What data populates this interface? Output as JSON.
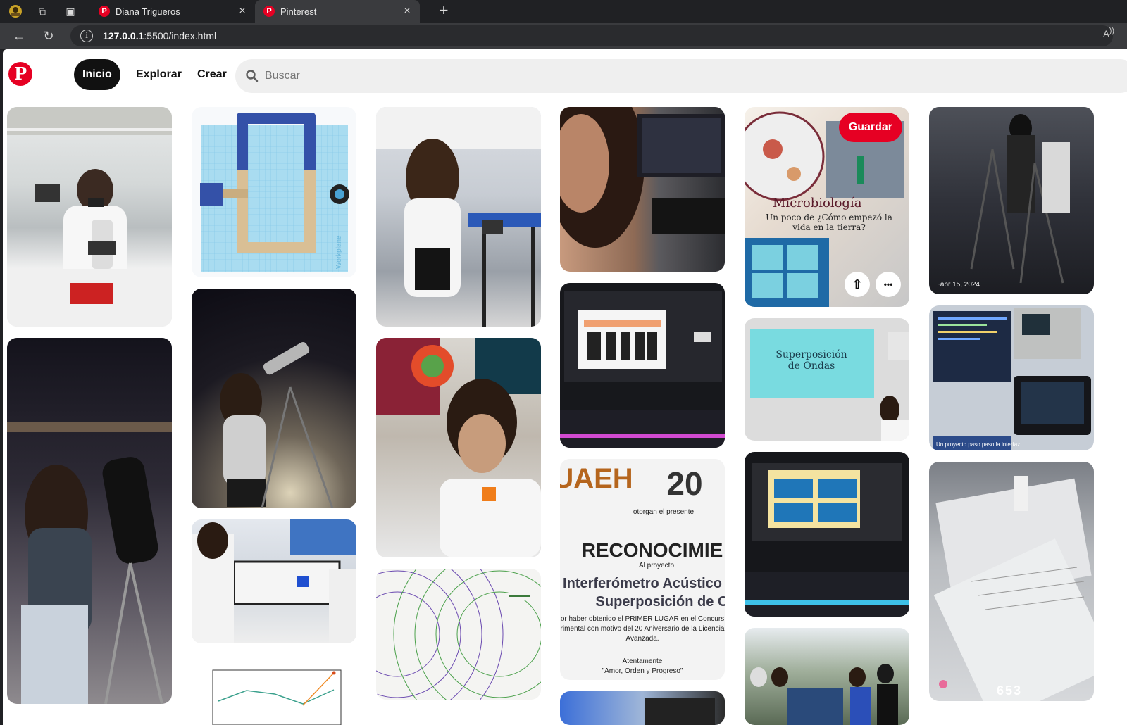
{
  "browser": {
    "tabs": [
      {
        "label": "Diana Trigueros",
        "close": "×"
      },
      {
        "label": "Pinterest",
        "close": "×"
      }
    ],
    "new_tab": "+",
    "url_host": "127.0.0.1",
    "url_rest": ":5500/index.html"
  },
  "header": {
    "logo": "P",
    "nav": {
      "home": "Inicio",
      "explore": "Explorar",
      "create": "Crear"
    },
    "search_placeholder": "Buscar"
  },
  "pins": {
    "save_label": "Guardar",
    "more_label": "•••",
    "share_label": "⇧",
    "microbio_title": "Microbiología",
    "microbio_sub": "Un poco de ¿Cómo empezó la vida en la tierra?",
    "ondas_title": "Superposición de Ondas",
    "date_stamp": "~apr 15, 2024",
    "cert_logo": "UAEH",
    "cert_anniv": "20",
    "cert_otorgan": "otorgan el presente",
    "cert_title": "RECONOCIMIE",
    "cert_proyecto": "Al proyecto",
    "cert_line1": "Interferómetro Acústico",
    "cert_line2": "Superposición de O",
    "cert_body1": "or haber obtenido el PRIMER LUGAR en el Concurs",
    "cert_body2": "rimental con motivo del 20 Aniversario de la Licencia",
    "cert_body3": "Avanzada.",
    "cert_atentamente": "Atentamente",
    "cert_motto": "\"Amor, Orden y Progreso\"",
    "notebook_counter": "653",
    "circuit_caption": "Un proyecto paso paso la interfaz"
  },
  "colors": {
    "brand": "#e60023",
    "chrome_bg": "#202124",
    "chrome_tab": "#3a3b3e"
  }
}
